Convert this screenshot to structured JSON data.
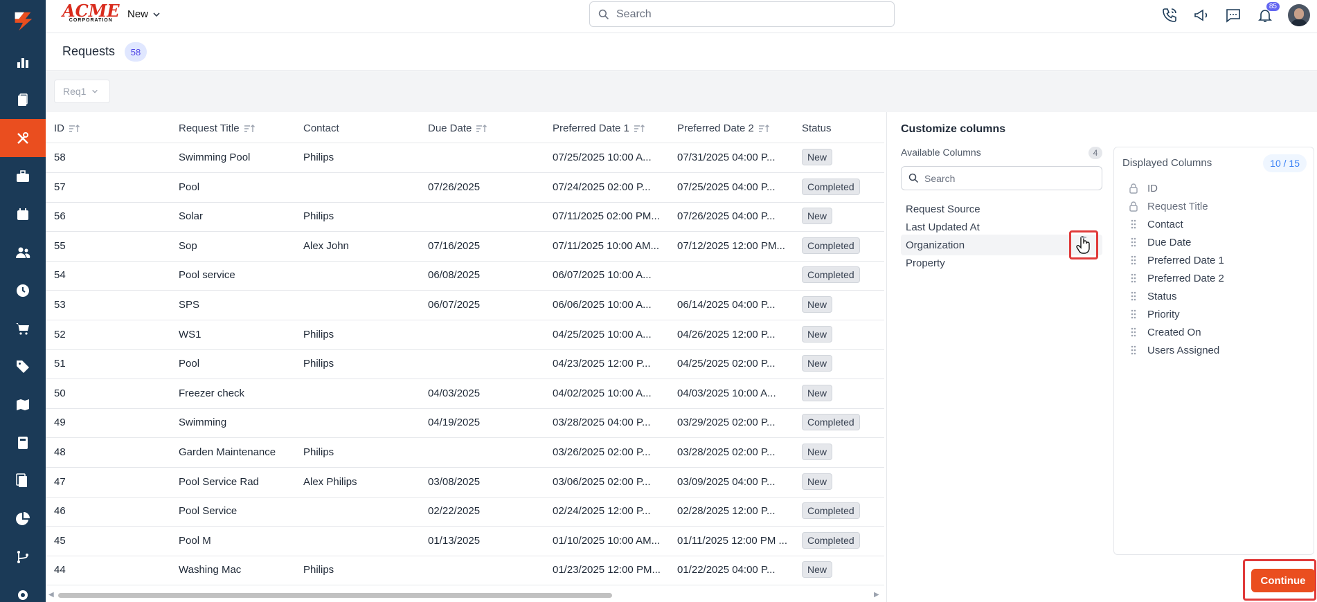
{
  "app": {
    "brand_top": "ACME",
    "brand_bottom": "CORPORATION",
    "new_menu_label": "New",
    "search_placeholder": "Search",
    "notification_count": "85",
    "accent_color": "#ea4e1f",
    "sidebar_color": "#1b3a57"
  },
  "sidebar": {
    "items": [
      {
        "icon": "bar-chart-icon"
      },
      {
        "icon": "clipboard-icon"
      },
      {
        "icon": "tools-icon",
        "active": true
      },
      {
        "icon": "briefcase-icon"
      },
      {
        "icon": "calendar-icon"
      },
      {
        "icon": "users-icon"
      },
      {
        "icon": "clock-icon"
      },
      {
        "icon": "cart-icon"
      },
      {
        "icon": "tag-icon"
      },
      {
        "icon": "map-icon"
      },
      {
        "icon": "calculator-icon"
      },
      {
        "icon": "documents-icon"
      },
      {
        "icon": "pie-chart-icon"
      },
      {
        "icon": "workflow-icon"
      },
      {
        "icon": "settings-icon"
      }
    ]
  },
  "page": {
    "title": "Requests",
    "count": "58",
    "view_select": "Req1"
  },
  "table": {
    "columns": [
      "ID",
      "Request Title",
      "Contact",
      "Due Date",
      "Preferred Date 1",
      "Preferred Date 2",
      "Status"
    ],
    "rows": [
      {
        "id": "58",
        "title": "Swimming Pool",
        "contact": "Philips",
        "due": "",
        "pd1": "07/25/2025 10:00 A...",
        "pd2": "07/31/2025 04:00 P...",
        "status": "New"
      },
      {
        "id": "57",
        "title": "Pool",
        "contact": "",
        "due": "07/26/2025",
        "pd1": "07/24/2025 02:00 P...",
        "pd2": "07/25/2025 04:00 P...",
        "status": "Completed"
      },
      {
        "id": "56",
        "title": "Solar",
        "contact": "Philips",
        "due": "",
        "pd1": "07/11/2025 02:00 PM...",
        "pd2": "07/26/2025 04:00 P...",
        "status": "New"
      },
      {
        "id": "55",
        "title": "Sop",
        "contact": "Alex John",
        "due": "07/16/2025",
        "pd1": "07/11/2025 10:00 AM...",
        "pd2": "07/12/2025 12:00 PM...",
        "status": "Completed"
      },
      {
        "id": "54",
        "title": "Pool service",
        "contact": "",
        "due": "06/08/2025",
        "pd1": "06/07/2025 10:00 A...",
        "pd2": "",
        "status": "Completed"
      },
      {
        "id": "53",
        "title": "SPS",
        "contact": "",
        "due": "06/07/2025",
        "pd1": "06/06/2025 10:00 A...",
        "pd2": "06/14/2025 04:00 P...",
        "status": "New"
      },
      {
        "id": "52",
        "title": "WS1",
        "contact": "Philips",
        "due": "",
        "pd1": "04/25/2025 10:00 A...",
        "pd2": "04/26/2025 12:00 P...",
        "status": "New"
      },
      {
        "id": "51",
        "title": "Pool",
        "contact": "Philips",
        "due": "",
        "pd1": "04/23/2025 12:00 P...",
        "pd2": "04/25/2025 02:00 P...",
        "status": "New"
      },
      {
        "id": "50",
        "title": "Freezer check",
        "contact": "",
        "due": "04/03/2025",
        "pd1": "04/02/2025 10:00 A...",
        "pd2": "04/03/2025 10:00 A...",
        "status": "New"
      },
      {
        "id": "49",
        "title": "Swimming",
        "contact": "",
        "due": "04/19/2025",
        "pd1": "03/28/2025 04:00 P...",
        "pd2": "03/29/2025 02:00 P...",
        "status": "Completed"
      },
      {
        "id": "48",
        "title": "Garden Maintenance",
        "contact": "Philips",
        "due": "",
        "pd1": "03/26/2025 02:00 P...",
        "pd2": "03/28/2025 02:00 P...",
        "status": "New"
      },
      {
        "id": "47",
        "title": "Pool Service Rad",
        "contact": "Alex Philips",
        "due": "03/08/2025",
        "pd1": "03/06/2025 02:00 P...",
        "pd2": "03/09/2025 04:00 P...",
        "status": "New"
      },
      {
        "id": "46",
        "title": "Pool Service",
        "contact": "",
        "due": "02/22/2025",
        "pd1": "02/24/2025 12:00 P...",
        "pd2": "02/28/2025 12:00 P...",
        "status": "Completed"
      },
      {
        "id": "45",
        "title": "Pool M",
        "contact": "",
        "due": "01/13/2025",
        "pd1": "01/10/2025 10:00 AM...",
        "pd2": "01/11/2025 12:00 PM ...",
        "status": "Completed"
      },
      {
        "id": "44",
        "title": "Washing Mac",
        "contact": "Philips",
        "due": "",
        "pd1": "01/23/2025 12:00 PM...",
        "pd2": "01/22/2025 04:00 P...",
        "status": "New"
      }
    ]
  },
  "customize": {
    "title": "Customize columns",
    "available_label": "Available Columns",
    "available_count": "4",
    "search_placeholder": "Search",
    "available": [
      "Request Source",
      "Last Updated At",
      "Organization",
      "Property"
    ],
    "displayed_label": "Displayed Columns",
    "displayed_count": "10 / 15",
    "displayed": [
      {
        "label": "ID",
        "locked": true
      },
      {
        "label": "Request Title",
        "locked": true
      },
      {
        "label": "Contact",
        "locked": false
      },
      {
        "label": "Due Date",
        "locked": false
      },
      {
        "label": "Preferred Date 1",
        "locked": false
      },
      {
        "label": "Preferred Date 2",
        "locked": false
      },
      {
        "label": "Status",
        "locked": false
      },
      {
        "label": "Priority",
        "locked": false
      },
      {
        "label": "Created On",
        "locked": false
      },
      {
        "label": "Users Assigned",
        "locked": false
      }
    ],
    "continue_label": "Continue"
  }
}
